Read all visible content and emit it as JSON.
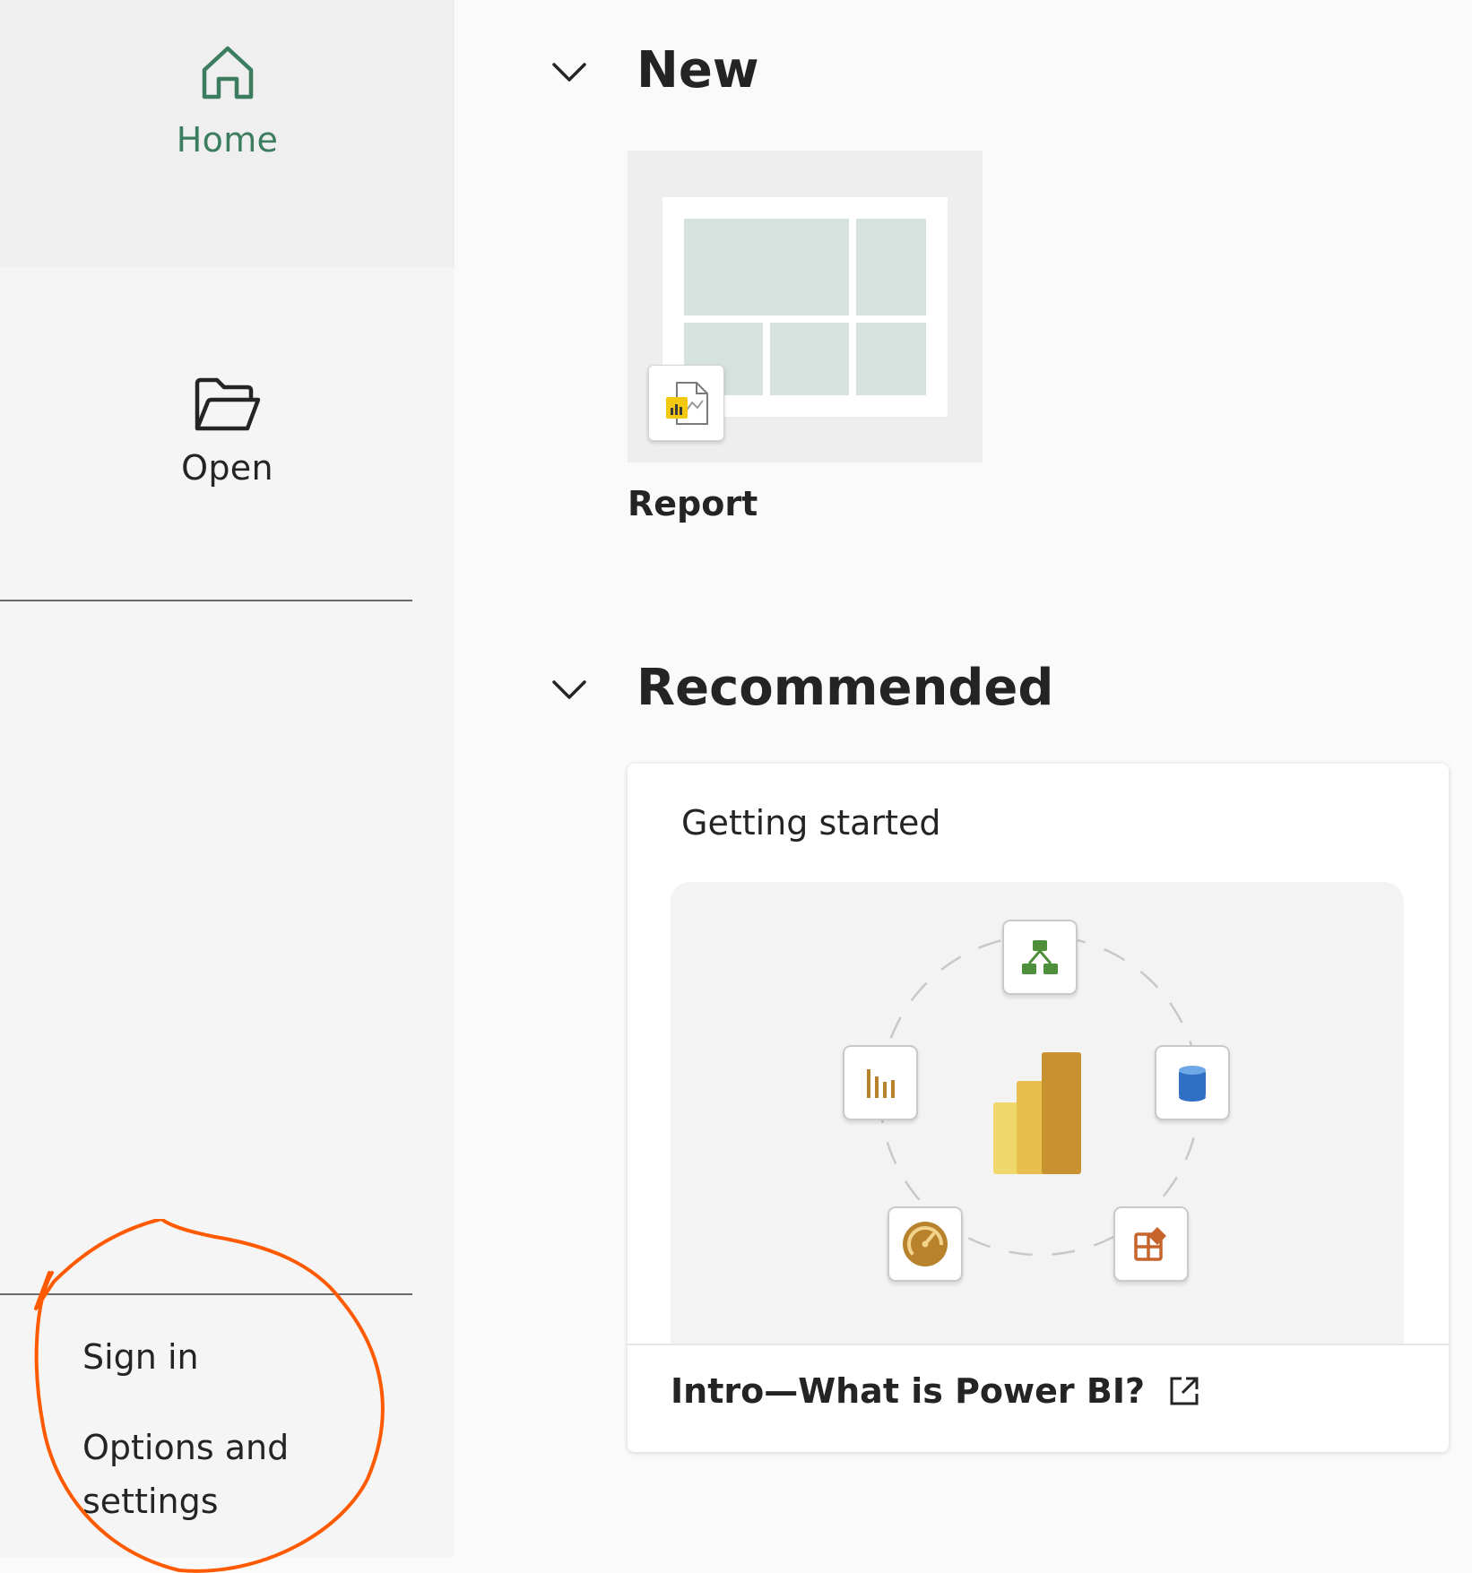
{
  "sidebar": {
    "home_label": "Home",
    "open_label": "Open",
    "sign_in_label": "Sign in",
    "options_label": "Options and settings"
  },
  "sections": {
    "new_title": "New",
    "recommended_title": "Recommended"
  },
  "new_items": {
    "report_label": "Report"
  },
  "recommended_card": {
    "title": "Getting started",
    "link_text": "Intro—What is Power BI?"
  },
  "colors": {
    "accent_green": "#3c7d60",
    "annotation_orange": "#ff5a00",
    "powerbi_gold": "#e8b84a"
  },
  "icons": [
    "home-icon",
    "folder-open-icon",
    "chevron-down-icon",
    "report-file-icon",
    "external-link-icon",
    "dataflow-icon",
    "bar-chart-icon",
    "database-icon",
    "gauge-icon",
    "dashboard-icon",
    "power-bi-logo"
  ]
}
